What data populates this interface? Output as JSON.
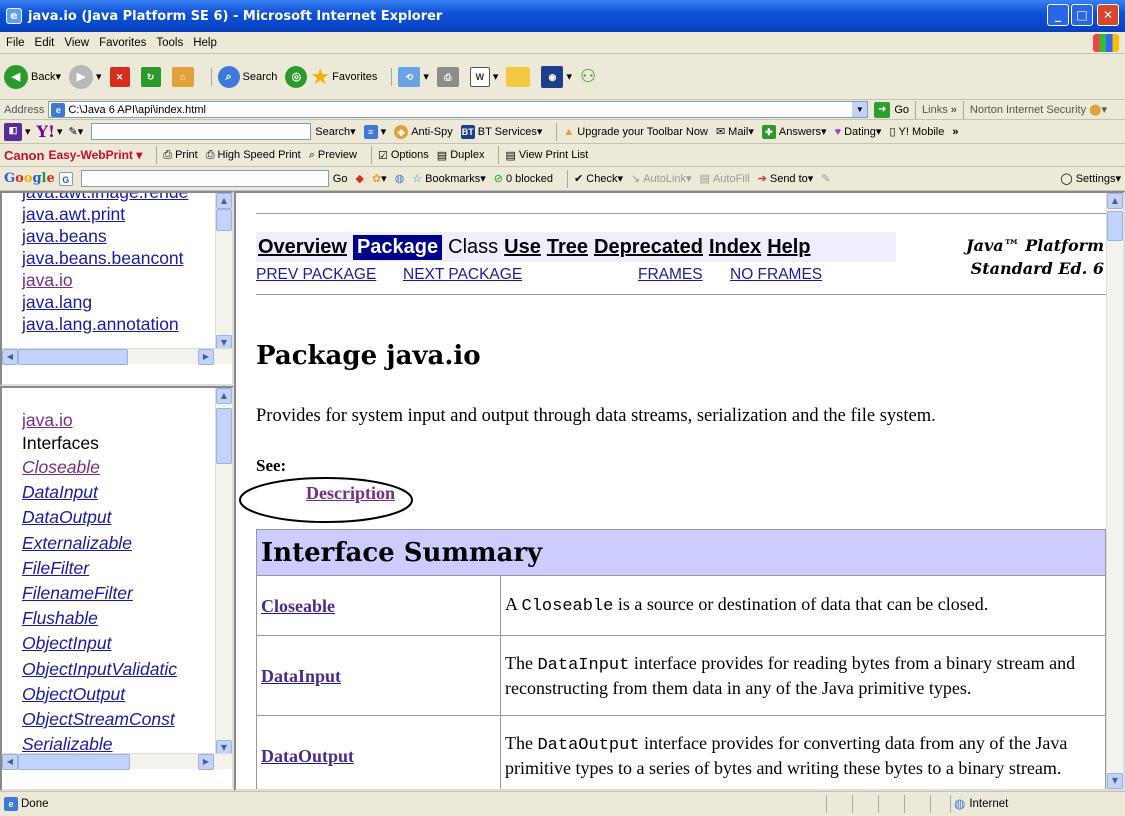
{
  "window": {
    "title": "java.io (Java Platform SE 6) - Microsoft Internet Explorer"
  },
  "menu": [
    "File",
    "Edit",
    "View",
    "Favorites",
    "Tools",
    "Help"
  ],
  "toolbar": {
    "back": "Back",
    "search": "Search",
    "favorites": "Favorites"
  },
  "address": {
    "label": "Address",
    "url": "C:\\Java 6 API\\api\\index.html",
    "go": "Go",
    "links": "Links",
    "norton": "Norton Internet Security"
  },
  "yahoo": {
    "search": "Search",
    "antispy": "Anti-Spy",
    "bt": "BT Services",
    "upgrade": "Upgrade your Toolbar Now",
    "mail": "Mail",
    "answers": "Answers",
    "dating": "Dating",
    "mobile": "Y! Mobile"
  },
  "canon": {
    "brand": "Canon",
    "product": "Easy-WebPrint",
    "print": "Print",
    "highspeed": "High Speed Print",
    "preview": "Preview",
    "options": "Options",
    "duplex": "Duplex",
    "viewlist": "View Print List"
  },
  "google": {
    "go": "Go",
    "bookmarks": "Bookmarks",
    "blocked": "0 blocked",
    "check": "Check",
    "autolink": "AutoLink",
    "autofill": "AutoFill",
    "sendto": "Send to",
    "settings": "Settings"
  },
  "packages_frame": {
    "items": [
      "java.awt.image.rende",
      "java.awt.print",
      "java.beans",
      "java.beans.beancont",
      "java.io",
      "java.lang",
      "java.lang.annotation"
    ]
  },
  "classes_frame": {
    "package": "java.io",
    "heading": "Interfaces",
    "items": [
      "Closeable",
      "DataInput",
      "DataOutput",
      "Externalizable",
      "FileFilter",
      "FilenameFilter",
      "Flushable",
      "ObjectInput",
      "ObjectInputValidatic",
      "ObjectOutput",
      "ObjectStreamConst",
      "Serializable"
    ]
  },
  "main": {
    "nav": {
      "overview": "Overview",
      "package": "Package",
      "class": "Class",
      "use": "Use",
      "tree": "Tree",
      "deprecated": "Deprecated",
      "index": "Index",
      "help": "Help",
      "prev": "PREV PACKAGE",
      "next": "NEXT PACKAGE",
      "frames": "FRAMES",
      "noframes": "NO FRAMES"
    },
    "platform_line1": "Java™ Platform",
    "platform_line2": "Standard Ed. 6",
    "title": "Package java.io",
    "description": "Provides for system input and output through data streams, serialization and the file system.",
    "see": "See:",
    "desc_link": "Description",
    "summary_title": "Interface Summary",
    "rows": [
      {
        "name": "Closeable",
        "pre": "A ",
        "code": "Closeable",
        "post": " is a source or destination of data that can be closed."
      },
      {
        "name": "DataInput",
        "pre": "The ",
        "code": "DataInput",
        "post": " interface provides for reading bytes from a binary stream and reconstructing from them data in any of the Java primitive types."
      },
      {
        "name": "DataOutput",
        "pre": "The ",
        "code": "DataOutput",
        "post": " interface provides for converting data from any of the Java primitive types to a series of bytes and writing these bytes to a binary stream."
      }
    ]
  },
  "status": {
    "text": "Done",
    "zone": "Internet"
  }
}
